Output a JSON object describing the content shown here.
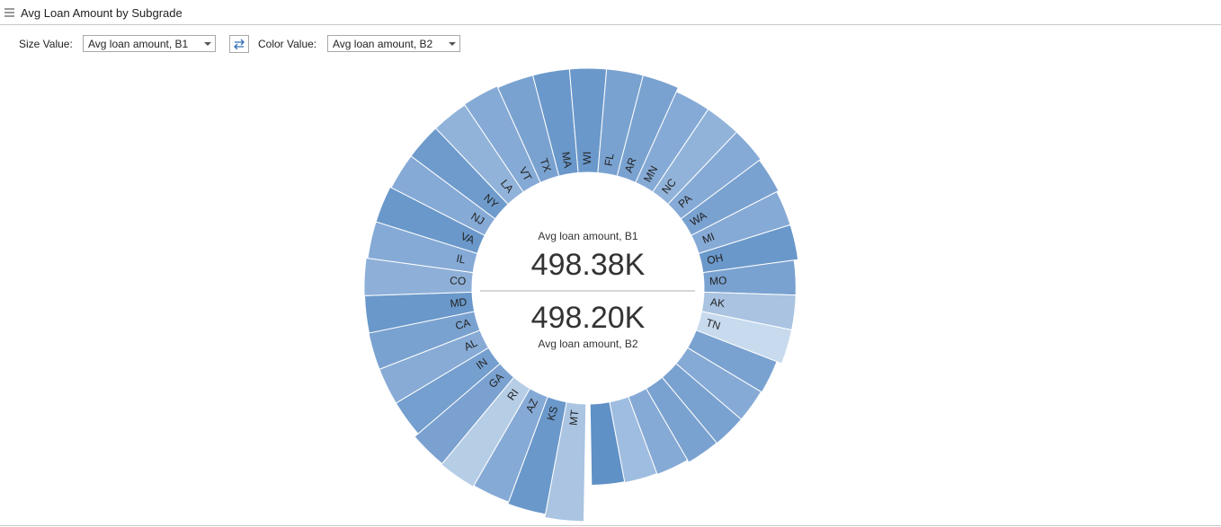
{
  "header": {
    "title": "Avg Loan Amount by Subgrade",
    "menu_icon": "hamburger-icon"
  },
  "controls": {
    "size_label": "Size Value:",
    "size_value": "Avg loan amount, B1",
    "swap_icon": "swap-arrows-icon",
    "color_label": "Color Value:",
    "color_value": "Avg loan amount, B2"
  },
  "chart_data": {
    "type": "sunburst",
    "center": {
      "top_label": "Avg loan amount, B1",
      "top_value": "498.38K",
      "bottom_value": "498.20K",
      "bottom_label": "Avg loan amount, B2"
    },
    "segments": [
      {
        "state": "MT",
        "size": 12.3,
        "color": "#aac4e2"
      },
      {
        "state": "KS",
        "size": 11.5,
        "color": "#6a98ca"
      },
      {
        "state": "AZ",
        "size": 11.0,
        "color": "#86aad6"
      },
      {
        "state": "RI",
        "size": 11.3,
        "color": "#b6cde6"
      },
      {
        "state": "GA",
        "size": 11.0,
        "color": "#7aa1d0"
      },
      {
        "state": "IN",
        "size": 9.9,
        "color": "#749fce"
      },
      {
        "state": "AL",
        "size": 9.9,
        "color": "#88abd6"
      },
      {
        "state": "CA",
        "size": 9.9,
        "color": "#7aa2d0"
      },
      {
        "state": "MD",
        "size": 9.8,
        "color": "#6a98ca"
      },
      {
        "state": "CO",
        "size": 9.9,
        "color": "#8eb0d8"
      },
      {
        "state": "IL",
        "size": 9.5,
        "color": "#86aad6"
      },
      {
        "state": "VA",
        "size": 9.5,
        "color": "#6a98ca"
      },
      {
        "state": "NJ",
        "size": 9.2,
        "color": "#86aad6"
      },
      {
        "state": "NY",
        "size": 9.2,
        "color": "#6e9bcc"
      },
      {
        "state": "LA",
        "size": 9.2,
        "color": "#92b3d9"
      },
      {
        "state": "VT",
        "size": 9.4,
        "color": "#86aad6"
      },
      {
        "state": "TX",
        "size": 9.0,
        "color": "#7aa2d0"
      },
      {
        "state": "MA",
        "size": 9.0,
        "color": "#6a98ca"
      },
      {
        "state": "WI",
        "size": 9.0,
        "color": "#6a98ca"
      },
      {
        "state": "FL",
        "size": 9.0,
        "color": "#7aa2d0"
      },
      {
        "state": "AR",
        "size": 9.0,
        "color": "#7aa2d0"
      },
      {
        "state": "MN",
        "size": 7.9,
        "color": "#86aad6"
      },
      {
        "state": "NC",
        "size": 7.9,
        "color": "#92b3d9"
      },
      {
        "state": "PA",
        "size": 7.9,
        "color": "#86aad6"
      },
      {
        "state": "WA",
        "size": 7.5,
        "color": "#7aa2d0"
      },
      {
        "state": "MI",
        "size": 7.0,
        "color": "#86aad6"
      },
      {
        "state": "OH",
        "size": 7.0,
        "color": "#6a98ca"
      },
      {
        "state": "MO",
        "size": 6.0,
        "color": "#7aa2d0"
      },
      {
        "state": "AK",
        "size": 6.0,
        "color": "#a9c3e1"
      },
      {
        "state": "TN",
        "size": 6.0,
        "color": "#c8daee"
      },
      {
        "state": "",
        "size": 4.7,
        "color": "#7aa2d0"
      },
      {
        "state": "",
        "size": 4.5,
        "color": "#86aad6"
      },
      {
        "state": "",
        "size": 4.5,
        "color": "#7aa2d0"
      },
      {
        "state": "",
        "size": 4.4,
        "color": "#7aa2d0"
      },
      {
        "state": "",
        "size": 3.8,
        "color": "#86aad6"
      },
      {
        "state": "",
        "size": 3.6,
        "color": "#9fbde0"
      },
      {
        "state": "",
        "size": 3.4,
        "color": "#5f90c6"
      }
    ]
  }
}
